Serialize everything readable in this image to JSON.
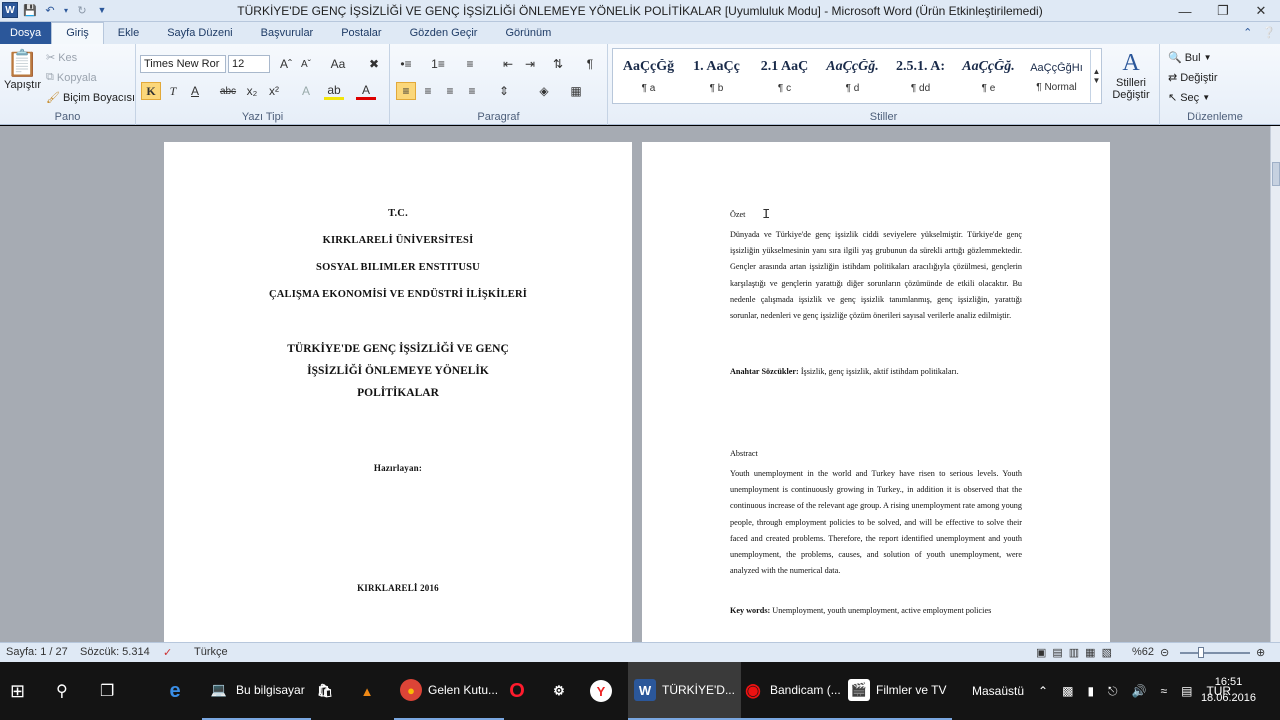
{
  "titlebar": {
    "title": "TÜRKİYE'DE GENÇ İŞSİZLİĞİ VE GENÇ İŞSİZLİĞİ ÖNLEMEYE YÖNELİK POLİTİKALAR [Uyumluluk Modu] - Microsoft Word (Ürün Etkinleştirilemedi)",
    "app_icon": "W"
  },
  "tabs": [
    "Dosya",
    "Giriş",
    "Ekle",
    "Sayfa Düzeni",
    "Başvurular",
    "Postalar",
    "Gözden Geçir",
    "Görünüm"
  ],
  "ribbon": {
    "pano": {
      "label": "Pano",
      "paste": "Yapıştır",
      "cut": "Kes",
      "copy": "Kopyala",
      "format_painter": "Biçim Boyacısı"
    },
    "font": {
      "label": "Yazı Tipi",
      "font_name": "Times New Ror",
      "font_size": "12",
      "bold": "K",
      "italic": "T",
      "case": "Aa"
    },
    "paragraph": {
      "label": "Paragraf"
    },
    "styles": {
      "label": "Stiller",
      "items": [
        {
          "preview": "AaÇçĞğ",
          "name": "¶ a"
        },
        {
          "preview": "1. AaÇç",
          "name": "¶ b"
        },
        {
          "preview": "2.1 AaÇ",
          "name": "¶ c"
        },
        {
          "preview": "AaÇçĞğ.",
          "name": "¶ d"
        },
        {
          "preview": "2.5.1. A:",
          "name": "¶ dd"
        },
        {
          "preview": "AaÇçĞğ.",
          "name": "¶ e"
        },
        {
          "preview": "AaÇçĞğHı",
          "name": "¶ Normal"
        }
      ],
      "change_styles": "Stilleri Değiştir"
    },
    "editing": {
      "label": "Düzenleme",
      "find": "Bul",
      "replace": "Değiştir",
      "select": "Seç"
    }
  },
  "page1": {
    "tc": "T.C.",
    "university": "KIRKLARELİ ÜNİVERSİTESİ",
    "institute": "SOSYAL BILIMLER ENSTITUSU",
    "department": "ÇALIŞMA EKONOMİSİ VE ENDÜSTRİ İLİŞKİLERİ",
    "title_line1": "TÜRKİYE'DE  GENÇ İŞSİZLİĞİ  VE GENÇ",
    "title_line2": "İŞSİZLİĞİ ÖNLEMEYE  YÖNELİK",
    "title_line3": "POLİTİKALAR",
    "prepared_by": "Hazırlayan:",
    "place_year": "KIRKLARELİ 2016"
  },
  "page2": {
    "ozet_heading": "Özet",
    "ozet_text": "Dünyada ve Türkiye'de genç işsizlik ciddi seviyelere yükselmiştir. Türkiye'de genç işsizliğin yükselmesinin yanı sıra ilgili yaş grubunun da sürekli arttığı gözlemmektedir. Gençler arasında artan işsizliğin istihdam politikaları aracılığıyla çözülmesi, gençlerin karşılaştığı ve gençlerin yarattığı diğer sorunların çözümünde de etkili olacaktır. Bu nedenle çalışmada işsizlik ve genç işsizlik tanımlanmış, genç işsizliğin, yarattığı sorunlar, nedenleri ve genç işsizliğe çözüm önerileri sayısal verilerle analiz edilmiştir.",
    "keywords_tr_label": "Anahtar Sözcükler:",
    "keywords_tr": " İşsizlik, genç işsizlik, aktif istihdam politikaları.",
    "abstract_heading": "Abstract",
    "abstract_text": "Youth unemployment in the world and Turkey have risen to serious levels. Youth unemployment is continuously growing in Turkey., in addition it is observed that the continuous increase of the relevant age group. A rising unemployment rate among young people, through employment policies to be solved, and will be effective to solve their faced and created problems. Therefore, the report identified unemployment and youth unemployment, the problems, causes, and solution of youth unemployment, were analyzed with the numerical data.",
    "keywords_en_label": "Key words:",
    "keywords_en": " Unemployment, youth unemployment, active employment policies"
  },
  "statusbar": {
    "page": "Sayfa: 1 / 27",
    "words": "Sözcük: 5.314",
    "language": "Türkçe",
    "zoom": "%62"
  },
  "taskbar": {
    "items": [
      {
        "label": "Bu bilgisayar"
      },
      {
        "label": "Gelen Kutu..."
      },
      {
        "label": "TÜRKİYE'D..."
      },
      {
        "label": "Bandicam (..."
      },
      {
        "label": "Filmler ve TV"
      }
    ],
    "desktop": "Masaüstü",
    "lang": "TUR",
    "time": "16:51",
    "date": "18.06.2016"
  }
}
